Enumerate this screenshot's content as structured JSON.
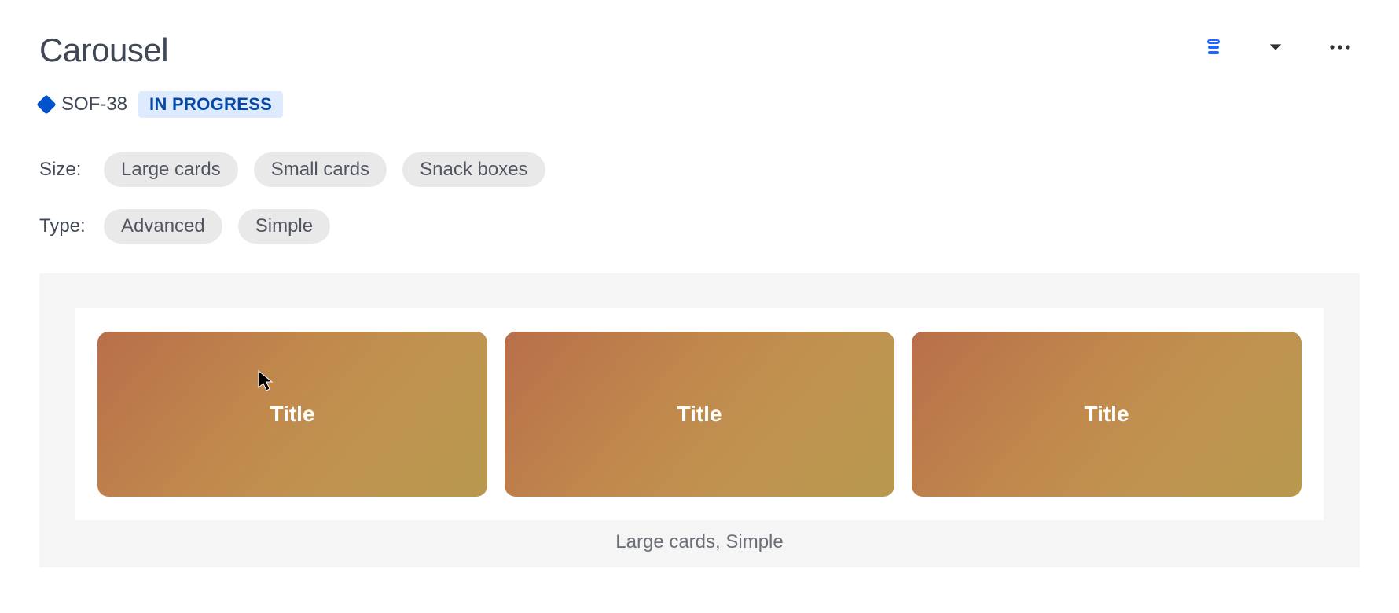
{
  "header": {
    "title": "Carousel",
    "issue_key": "SOF-38",
    "status": "IN PROGRESS"
  },
  "controls": {
    "size_label": "Size:",
    "size_options": [
      "Large cards",
      "Small cards",
      "Snack boxes"
    ],
    "type_label": "Type:",
    "type_options": [
      "Advanced",
      "Simple"
    ]
  },
  "preview": {
    "cards": [
      "Title",
      "Title",
      "Title"
    ],
    "caption": "Large cards, Simple"
  },
  "icons": {
    "stack": "stack-icon",
    "dropdown": "caret-down-icon",
    "more": "more-icon"
  }
}
